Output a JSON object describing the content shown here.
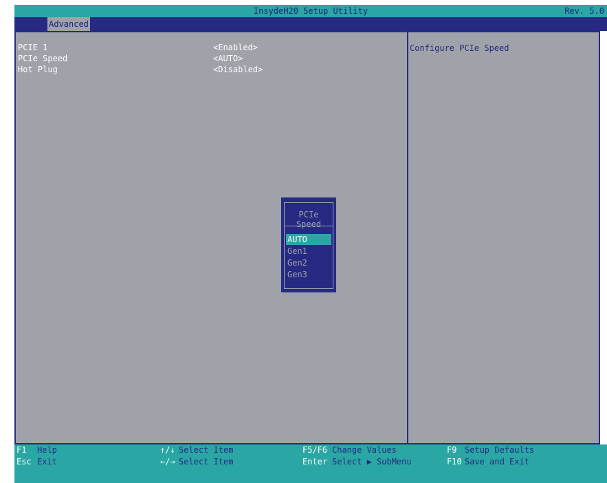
{
  "header": {
    "title": "InsydeH20 Setup Utility",
    "rev": "Rev. 5.0"
  },
  "tabs": [
    {
      "label": "Advanced"
    }
  ],
  "settings": [
    {
      "label": "PCIE 1",
      "value": "<Enabled>"
    },
    {
      "label": "PCIe Speed",
      "value": "<AUTO>"
    },
    {
      "label": "Hot Plug",
      "value": "<Disabled>"
    }
  ],
  "help": {
    "text": "Configure PCIe Speed"
  },
  "popup": {
    "title": "PCIe Speed",
    "options": [
      "AUTO",
      "Gen1",
      "Gen2",
      "Gen3"
    ],
    "selected": "AUTO"
  },
  "footer": [
    {
      "key": "F1",
      "desc": "Help"
    },
    {
      "key": "Esc",
      "desc": "Exit"
    },
    {
      "key": "↑/↓",
      "desc": "Select Item"
    },
    {
      "key": "←/→",
      "desc": "Select Item"
    },
    {
      "key": "F5/F6",
      "desc": "Change Values"
    },
    {
      "key": "Enter",
      "desc": "Select ▶ SubMenu"
    },
    {
      "key": "F9",
      "desc": "Setup Defaults"
    },
    {
      "key": "F10",
      "desc": "Save and Exit"
    }
  ],
  "colors": {
    "accent": "#2aa7a4",
    "panel": "#9fa2a8",
    "navy": "#262a83"
  }
}
